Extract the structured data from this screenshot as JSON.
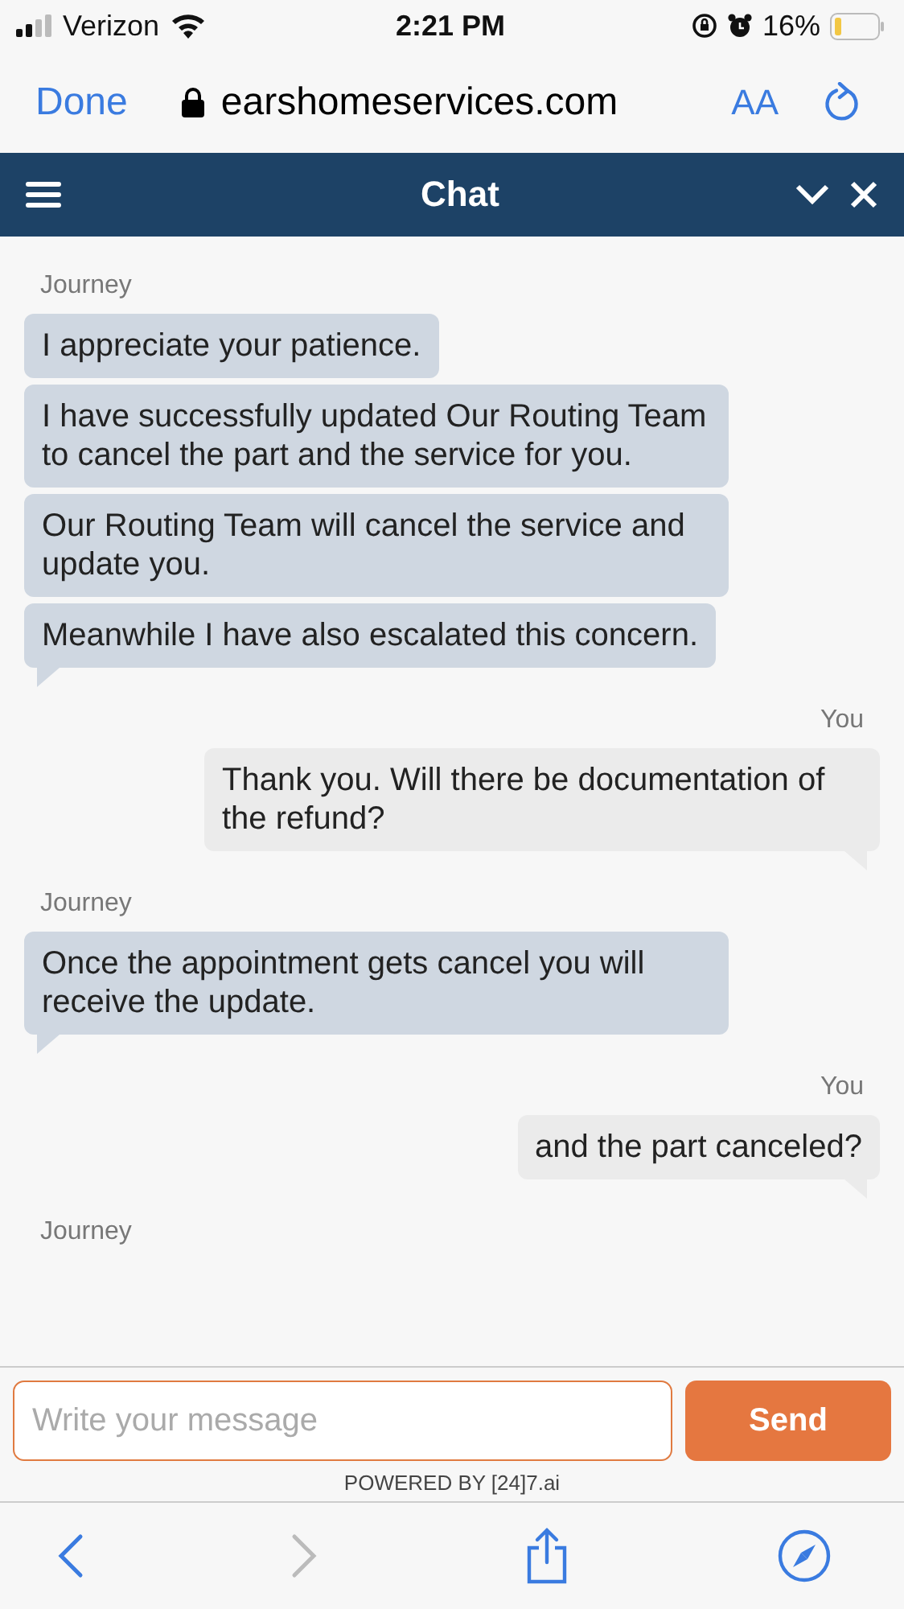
{
  "status_bar": {
    "carrier": "Verizon",
    "time": "2:21 PM",
    "battery": "16%"
  },
  "browser_bar": {
    "done": "Done",
    "url": "earshomeservices.com",
    "text_size": "AA"
  },
  "chat_header": {
    "title": "Chat"
  },
  "messages": [
    {
      "kind": "agent",
      "sender": "Journey",
      "bubbles": [
        "I appreciate your patience.",
        "I have successfully updated Our Routing Team to cancel the part and the service for you.",
        "Our Routing Team will cancel the service and update you.",
        "Meanwhile I have also escalated this concern."
      ]
    },
    {
      "kind": "user",
      "sender": "You",
      "bubbles": [
        "Thank you. Will there be documentation of the refund?"
      ]
    },
    {
      "kind": "agent",
      "sender": "Journey",
      "bubbles": [
        "Once the appointment gets cancel you will receive the update."
      ]
    },
    {
      "kind": "user",
      "sender": "You",
      "bubbles": [
        "and the part canceled?"
      ]
    },
    {
      "kind": "agent",
      "sender": "Journey"
    }
  ],
  "composer": {
    "placeholder": "Write your message",
    "send": "Send",
    "powered_by": "POWERED BY [24]7.ai"
  }
}
